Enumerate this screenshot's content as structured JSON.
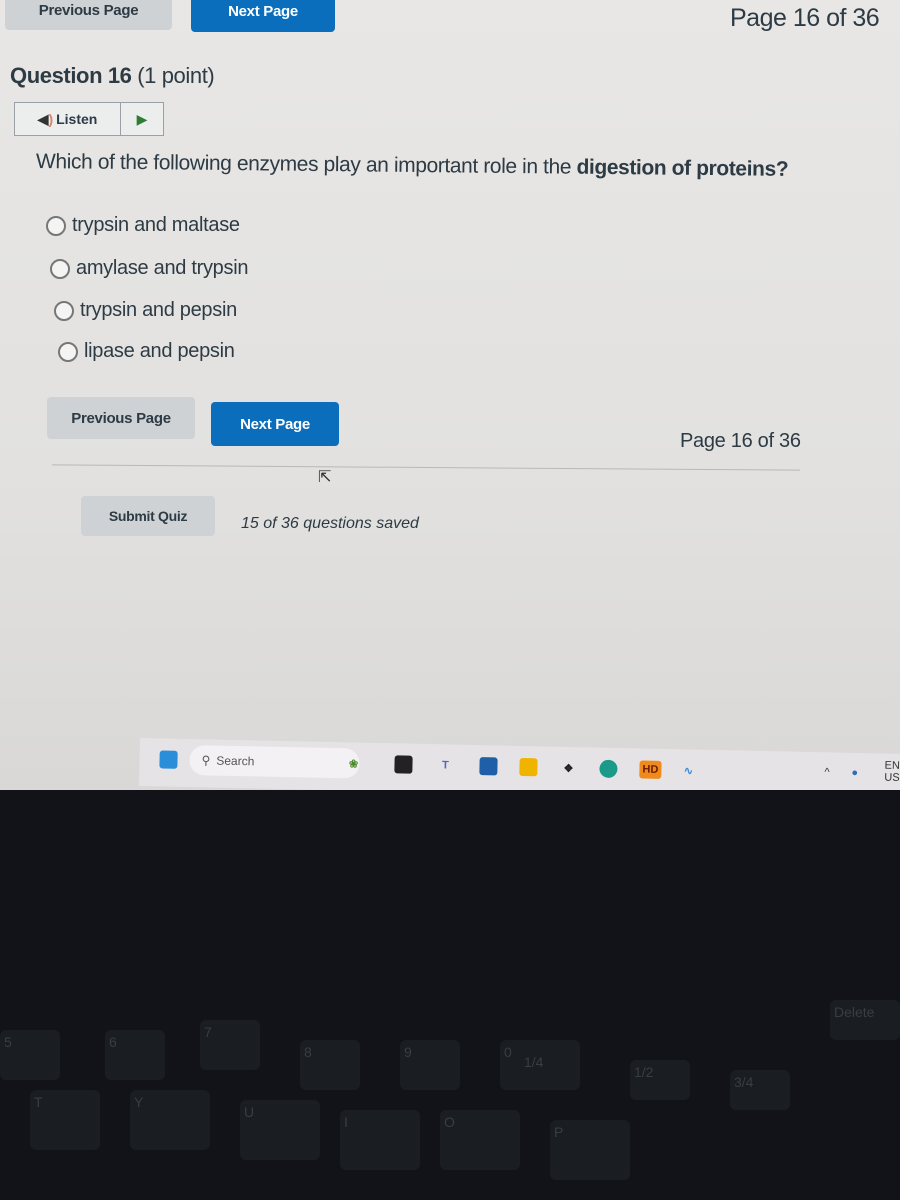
{
  "top_nav": {
    "previous_label": "Previous Page",
    "next_label": "Next Page",
    "page_indicator": "Page 16 of 36"
  },
  "question": {
    "title": "Question 16",
    "points": "(1 point)",
    "listen_label": "Listen",
    "text_plain": "Which of the following enzymes play an important role in the ",
    "text_bold": "digestion of proteins?",
    "options": [
      {
        "label": "trypsin and maltase",
        "selected": false
      },
      {
        "label": "amylase and trypsin",
        "selected": false
      },
      {
        "label": "trypsin and pepsin",
        "selected": false
      },
      {
        "label": "lipase and pepsin",
        "selected": false
      }
    ]
  },
  "bottom_nav": {
    "previous_label": "Previous Page",
    "next_label": "Next Page",
    "page_indicator": "Page 16 of 36",
    "submit_label": "Submit Quiz",
    "saved_status": "15 of 36 questions saved"
  },
  "taskbar": {
    "search_placeholder": "Search",
    "hd_badge": "HD",
    "lang_top": "EN",
    "lang_bottom": "US",
    "icons": [
      "windows-start-icon",
      "search-icon",
      "plant-widget-icon",
      "task-view-icon",
      "teams-icon",
      "store-icon",
      "file-explorer-icon",
      "dropbox-icon",
      "edge-icon",
      "hd-app-icon",
      "dolphin-app-icon",
      "tray-chevron-icon",
      "network-icon"
    ]
  },
  "keyboard": {
    "keys": [
      "5",
      "6",
      "7",
      "8",
      "9",
      "0",
      "T",
      "Y",
      "U",
      "I",
      "O",
      "P",
      "1/4",
      "1/2",
      "3/4",
      "Delete"
    ]
  }
}
